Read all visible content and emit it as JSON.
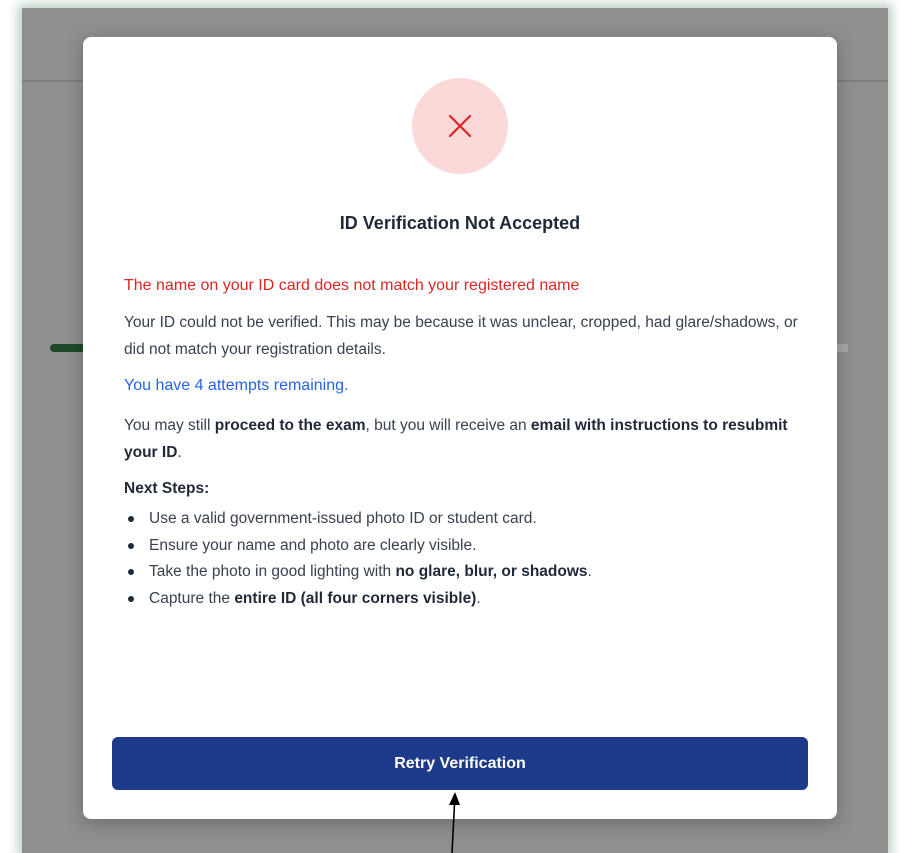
{
  "modal": {
    "title": "ID Verification Not Accepted",
    "error_message": "The name on your ID card does not match your registered name",
    "description": "Your ID could not be verified. This may be because it was unclear, cropped, had glare/shadows, or did not match your registration details.",
    "attempts_remaining": "You have 4 attempts remaining.",
    "proceed_notice": {
      "part1": "You may still ",
      "bold1": "proceed to the exam",
      "part2": ", but you will receive an ",
      "bold2": "email with instructions to resubmit your ID",
      "part3": "."
    },
    "next_steps_heading": "Next Steps:",
    "steps": [
      {
        "text": "Use a valid government-issued photo ID or student card."
      },
      {
        "text": "Ensure your name and photo are clearly visible."
      },
      {
        "pre": "Take the photo in good lighting with ",
        "bold": "no glare, blur, or shadows",
        "post": "."
      },
      {
        "pre": "Capture the ",
        "bold": "entire ID (all four corners visible)",
        "post": "."
      }
    ],
    "retry_button_label": "Retry Verification",
    "status_icon": "close-icon"
  },
  "colors": {
    "error": "#dc2626",
    "info": "#2563eb",
    "primary_button": "#1e3a8a",
    "status_circle": "#fbd9d9",
    "overlay": "#8f8f8f"
  }
}
